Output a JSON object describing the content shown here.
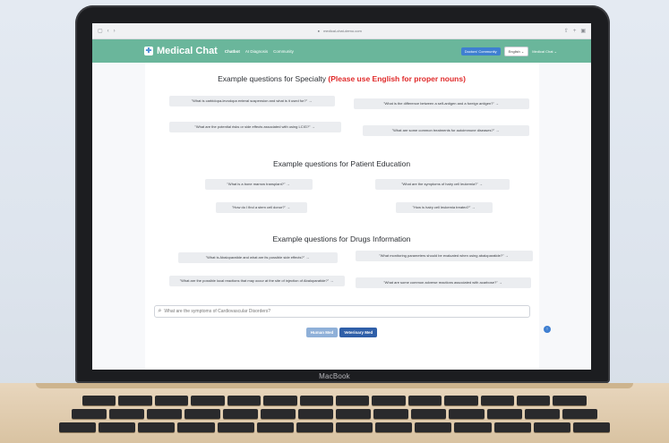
{
  "browser": {
    "url": "medical-chat-demo.com",
    "nav_icons": [
      "sidebar-icon",
      "back-icon",
      "forward-icon"
    ],
    "right_icons": [
      "share-icon",
      "plus-icon",
      "tabs-icon"
    ]
  },
  "header": {
    "logo_glyph": "✚",
    "title": "Medical Chat",
    "nav": [
      "Chatbot",
      "AI Diagnosis",
      "Community"
    ],
    "community_button": "Doctors' Community",
    "language": "English ⌄",
    "user": "Medical Chat ⌄",
    "color": "#6ab69b"
  },
  "sections": {
    "specialty": {
      "title": "Example questions for Specialty ",
      "warning": "(Please use English for proper nouns)",
      "questions": [
        "\"What is carbidopa-levodopa enteral suspension and what is it used for?\" →",
        "\"What is the difference between a self-antigen and a foreign antigen?\" →",
        "\"What are the potential risks or side effects associated with using LCIG?\" →",
        "\"What are some common treatments for autoimmune diseases?\" →"
      ]
    },
    "patient": {
      "title": "Example questions for Patient Education",
      "questions": [
        "\"What is a bone marrow transplant?\" →",
        "\"What are the symptoms of hairy cell leukemia?\" →",
        "\"How do I find a stem cell donor?\" →",
        "\"How is hairy cell leukemia treated?\" →"
      ]
    },
    "drugs": {
      "title": "Example questions for Drugs Information",
      "questions": [
        "\"What is Abaloparatide and what are its possible side effects?\" →",
        "\"What monitoring parameters should be evaluated when using abaloparatide?\" →",
        "\"What are the possible local reactions that may occur at the site of injection of Abaloparatide?\" →",
        "\"What are some common adverse reactions associated with acarbose?\" →"
      ]
    }
  },
  "chat": {
    "placeholder": "What are the symptoms of Cardiovascular Disorders?",
    "search_glyph": "⌕",
    "send_glyph": "↑"
  },
  "modes": {
    "human": "Human Med",
    "veterinary": "Veterinary Med",
    "active": "veterinary"
  },
  "device": {
    "label": "MacBook"
  }
}
